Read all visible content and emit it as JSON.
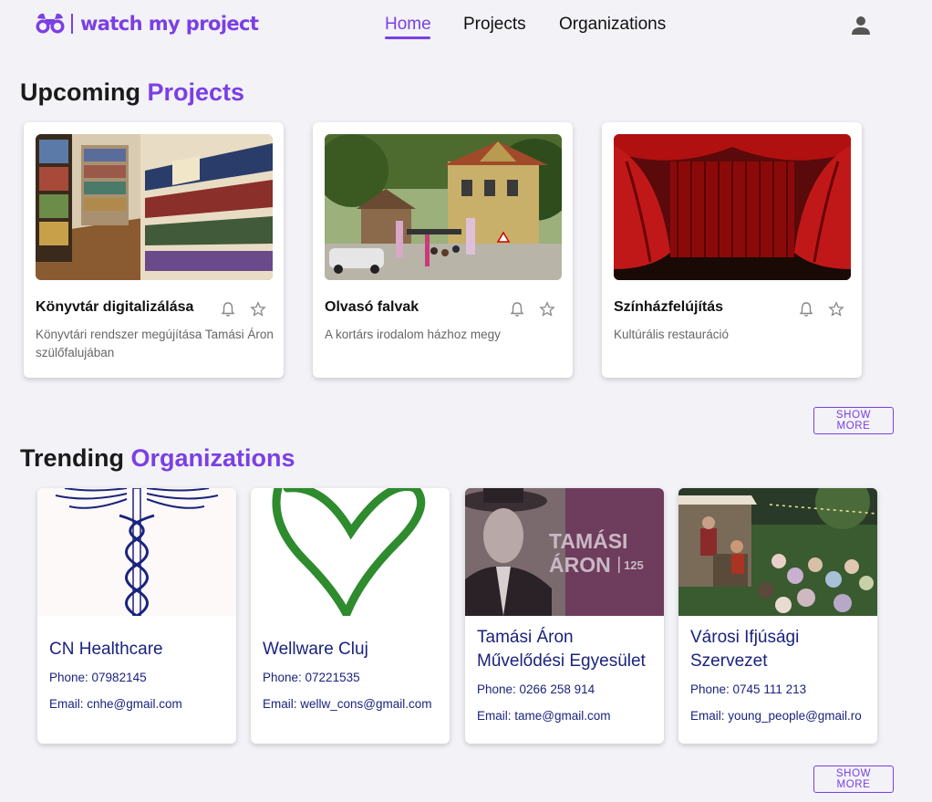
{
  "brand": {
    "name": "watch my project",
    "color": "#7b3fe4"
  },
  "nav": {
    "home": "Home",
    "projects": "Projects",
    "organizations": "Organizations"
  },
  "sections": {
    "projects": {
      "title_plain": "Upcoming",
      "title_accent": "Projects",
      "show_more": "SHOW MORE"
    },
    "organizations": {
      "title_plain": "Trending",
      "title_accent": "Organizations",
      "show_more": "SHOW MORE"
    }
  },
  "projects": [
    {
      "title": "Könyvtár digitalizálása",
      "description": "Könyvtári rendszer megújítása Tamási Áron szülőfalujában",
      "image": "library-shelves"
    },
    {
      "title": "Olvasó falvak",
      "description": "A kortárs irodalom házhoz megy",
      "image": "village-street"
    },
    {
      "title": "Színházfelújítás",
      "description": "Kultúrális restauráció",
      "image": "theater-curtain"
    }
  ],
  "organizations": [
    {
      "name": "CN Healthcare",
      "phone": "Phone: 07982145",
      "email": "Email: cnhe@gmail.com",
      "image": "caduceus"
    },
    {
      "name": "Wellware Cluj",
      "phone": "Phone: 07221535",
      "email": "Email: wellw_cons@gmail.com",
      "image": "green-heart"
    },
    {
      "name": "Tamási Áron Művelődési Egyesület",
      "phone": "Phone: 0266 258 914",
      "email": "Email: tame@gmail.com",
      "image": "portrait-poster",
      "poster_line1": "TAMÁSI",
      "poster_line2": "ÁRON",
      "poster_number": "125"
    },
    {
      "name": "Városi Ifjúsági Szervezet",
      "phone": "Phone: 0745 111 213",
      "email": "Email: young_people@gmail.ro",
      "image": "outdoor-concert"
    }
  ],
  "icons": {
    "bell": "bell-icon",
    "star": "star-outline-icon",
    "user": "account-icon",
    "logo": "binoculars-icon"
  }
}
